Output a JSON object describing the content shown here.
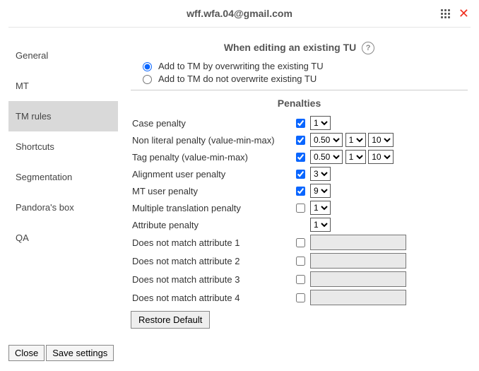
{
  "header": {
    "title": "wff.wfa.04@gmail.com"
  },
  "sidebar": {
    "items": [
      {
        "label": "General"
      },
      {
        "label": "MT"
      },
      {
        "label": "TM rules"
      },
      {
        "label": "Shortcuts"
      },
      {
        "label": "Segmentation"
      },
      {
        "label": "Pandora's box"
      },
      {
        "label": "QA"
      }
    ],
    "activeIndex": 2
  },
  "editing": {
    "heading": "When editing an existing TU",
    "radios": [
      {
        "label": "Add to TM by overwriting the existing TU",
        "checked": true
      },
      {
        "label": "Add to TM do not overwrite existing TU",
        "checked": false
      }
    ]
  },
  "penalties": {
    "heading": "Penalties",
    "rows": {
      "case": {
        "label": "Case penalty",
        "checked": true,
        "value": "1"
      },
      "nonlit": {
        "label": "Non literal penalty (value-min-max)",
        "checked": true,
        "value": "0.50",
        "min": "1",
        "max": "10"
      },
      "tag": {
        "label": "Tag penalty (value-min-max)",
        "checked": true,
        "value": "0.50",
        "min": "1",
        "max": "10"
      },
      "align": {
        "label": "Alignment user penalty",
        "checked": true,
        "value": "3"
      },
      "mtuser": {
        "label": "MT user penalty",
        "checked": true,
        "value": "9"
      },
      "multi": {
        "label": "Multiple translation penalty",
        "checked": false,
        "value": "1"
      },
      "attr": {
        "label": "Attribute penalty",
        "value": "1"
      },
      "nm1": {
        "label": "Does not match attribute 1",
        "checked": false,
        "text": ""
      },
      "nm2": {
        "label": "Does not match attribute 2",
        "checked": false,
        "text": ""
      },
      "nm3": {
        "label": "Does not match attribute 3",
        "checked": false,
        "text": ""
      },
      "nm4": {
        "label": "Does not match attribute 4",
        "checked": false,
        "text": ""
      }
    },
    "restore": "Restore Default"
  },
  "footer": {
    "close": "Close",
    "save": "Save settings"
  }
}
